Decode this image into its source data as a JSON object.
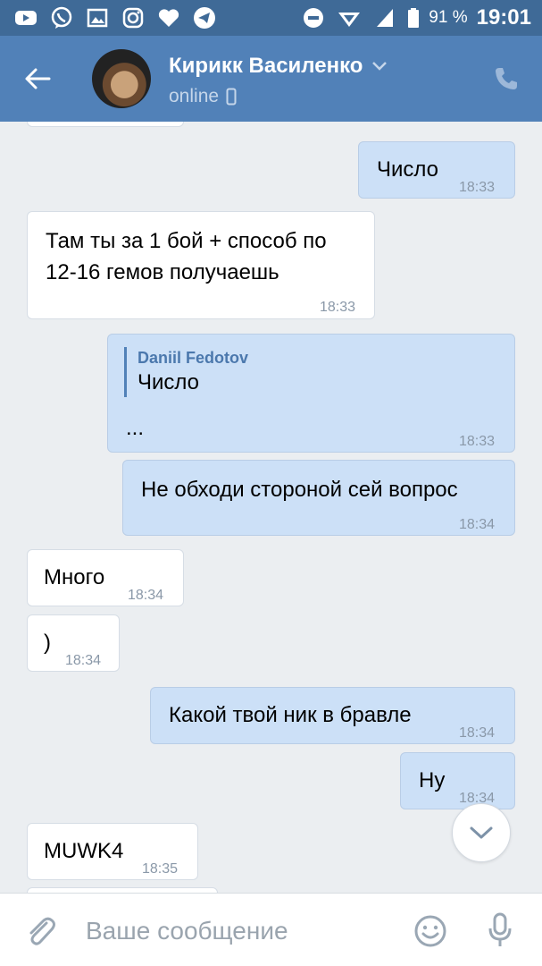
{
  "status_bar": {
    "battery": "91 %",
    "time": "19:01",
    "left_icons": [
      "youtube-icon",
      "viber-icon",
      "gallery-icon",
      "instagram-icon",
      "heart-icon",
      "telegram-icon"
    ]
  },
  "header": {
    "contact_name": "Кирикк Василенко",
    "status": "online"
  },
  "messages": [
    {
      "dir": "out",
      "text": "Число",
      "time": "18:33"
    },
    {
      "dir": "in",
      "lines": [
        "Там ты за 1 бой + способ по",
        "12-16 гемов получаешь"
      ],
      "time": "18:33"
    },
    {
      "dir": "out",
      "quote_author": "Daniil Fedotov",
      "quote_text": "Число",
      "text": "...",
      "time": "18:33"
    },
    {
      "dir": "out",
      "text": "Не обходи стороной сей вопрос",
      "time": "18:34"
    },
    {
      "dir": "in",
      "text": "Много",
      "time": "18:34"
    },
    {
      "dir": "in",
      "text": ")",
      "time": "18:34"
    },
    {
      "dir": "out",
      "text": "Какой твой ник в бравле",
      "time": "18:34"
    },
    {
      "dir": "out",
      "text": "Ну",
      "time": "18:34"
    },
    {
      "dir": "in",
      "text": "MUWK4",
      "time": "18:35"
    }
  ],
  "composer": {
    "placeholder": "Ваше сообщение"
  },
  "colors": {
    "header_bg": "#5181b8",
    "status_bar_bg": "#3f6a97",
    "chat_bg": "#ebeef1",
    "outgoing_bubble": "#cce0f7",
    "incoming_bubble": "#ffffff"
  }
}
